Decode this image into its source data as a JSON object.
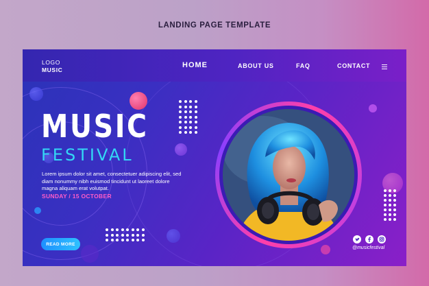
{
  "caption": "LANDING PAGE TEMPLATE",
  "logo": {
    "line1": "LOGO",
    "line2": "MUSIC"
  },
  "nav": {
    "home": "HOME",
    "about": "ABOUT US",
    "faq": "FAQ",
    "contact": "CONTACT",
    "menu_icon": "hamburger-icon"
  },
  "hero": {
    "title": "MUSIC",
    "subtitle": "FESTIVAL",
    "body": "Lorem ipsum dolor sit amet, consectetuer adipiscing elit, sed diam nonummy nibh euismod tincidunt ut laoreet dolore magna aliquam erat volutpat.",
    "date": "SUNDAY / 15 OCTOBER",
    "cta": "READ MORE"
  },
  "social": {
    "icons": [
      "twitter-icon",
      "facebook-icon",
      "instagram-icon"
    ],
    "handle": "@musicfestival"
  },
  "colors": {
    "accent_cyan": "#33d7f5",
    "accent_pink": "#ff5cc8",
    "button_blue": "#1e8fff",
    "bg_purple": "#5a24c6"
  }
}
